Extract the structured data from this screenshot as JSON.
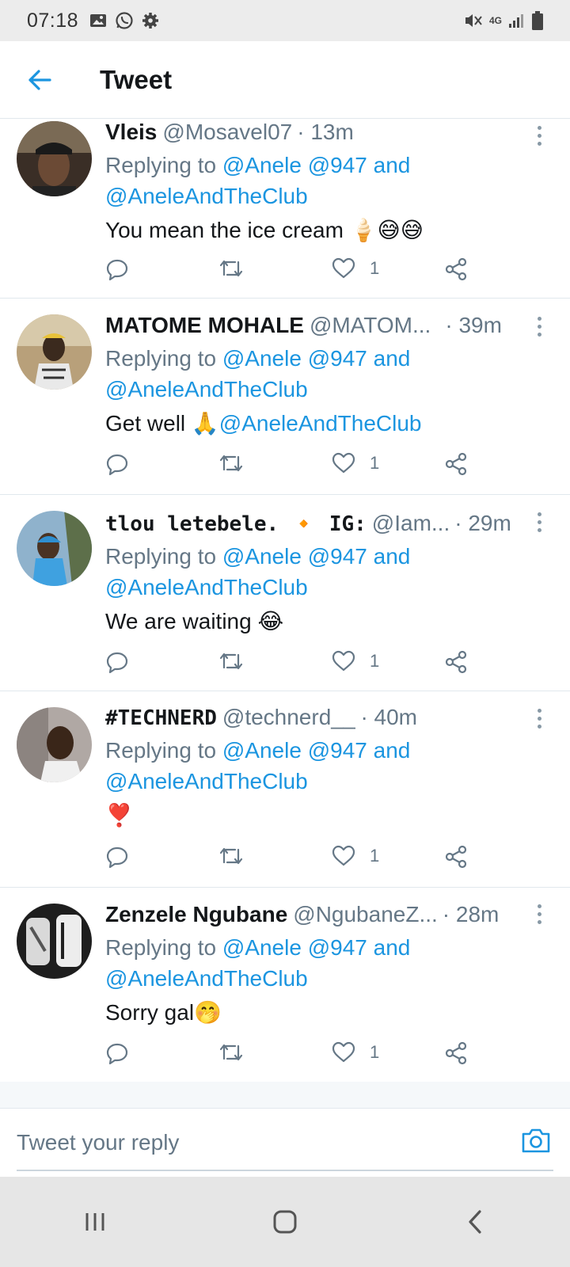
{
  "status_bar": {
    "time": "07:18",
    "network": "4G"
  },
  "app_bar": {
    "title": "Tweet"
  },
  "reply_prefix": "Replying to ",
  "tweets": [
    {
      "name": "Vleis",
      "handle": "@Mosavel07",
      "time": "· 13m",
      "replying_mentions": "@Anele @947",
      "replying_and": " and",
      "replying_line2": "@AneleAndTheClub",
      "text": "You mean the ice cream 🍦😅😅",
      "text_mention": "",
      "likes": "1",
      "avatar_color": "#4a3a2e"
    },
    {
      "name": "MATOME MOHALE",
      "handle": "@MATOM...",
      "time": "· 39m",
      "replying_mentions": "@Anele @947",
      "replying_and": " and",
      "replying_line2": "@AneleAndTheClub",
      "text": "Get well 🙏",
      "text_mention": "@AneleAndTheClub",
      "likes": "1",
      "avatar_color": "#c9a77a"
    },
    {
      "name": "tlou letebele. 🔸 IG:",
      "handle": "@Iam...",
      "time": "· 29m",
      "replying_mentions": "@Anele @947",
      "replying_and": " and",
      "replying_line2": "@AneleAndTheClub",
      "text": "We are waiting 😂",
      "text_mention": "",
      "likes": "1",
      "avatar_color": "#5b88b0"
    },
    {
      "name": "#TECHNERD",
      "handle": "@technerd__",
      "time": "· 40m",
      "replying_mentions": "@Anele @947",
      "replying_and": " and",
      "replying_line2": "@AneleAndTheClub",
      "text": "❣️",
      "text_mention": "",
      "likes": "1",
      "avatar_color": "#9d8c84"
    },
    {
      "name": "Zenzele Ngubane",
      "handle": "@NgubaneZ...",
      "time": "· 28m",
      "replying_mentions": "@Anele @947",
      "replying_and": " and",
      "replying_line2": "@AneleAndTheClub",
      "text": "Sorry gal🤭",
      "text_mention": "",
      "likes": "1",
      "avatar_color": "#262626"
    }
  ],
  "reply_box": {
    "placeholder": "Tweet your reply"
  },
  "colors": {
    "accent": "#1b95e0",
    "secondary_text": "#657786",
    "divider": "#e1e8ed"
  },
  "icons": [
    "back-arrow-icon",
    "more-vert-icon",
    "reply-icon",
    "retweet-icon",
    "like-icon",
    "share-icon",
    "camera-icon",
    "recent-apps-icon",
    "home-icon",
    "back-nav-icon"
  ]
}
